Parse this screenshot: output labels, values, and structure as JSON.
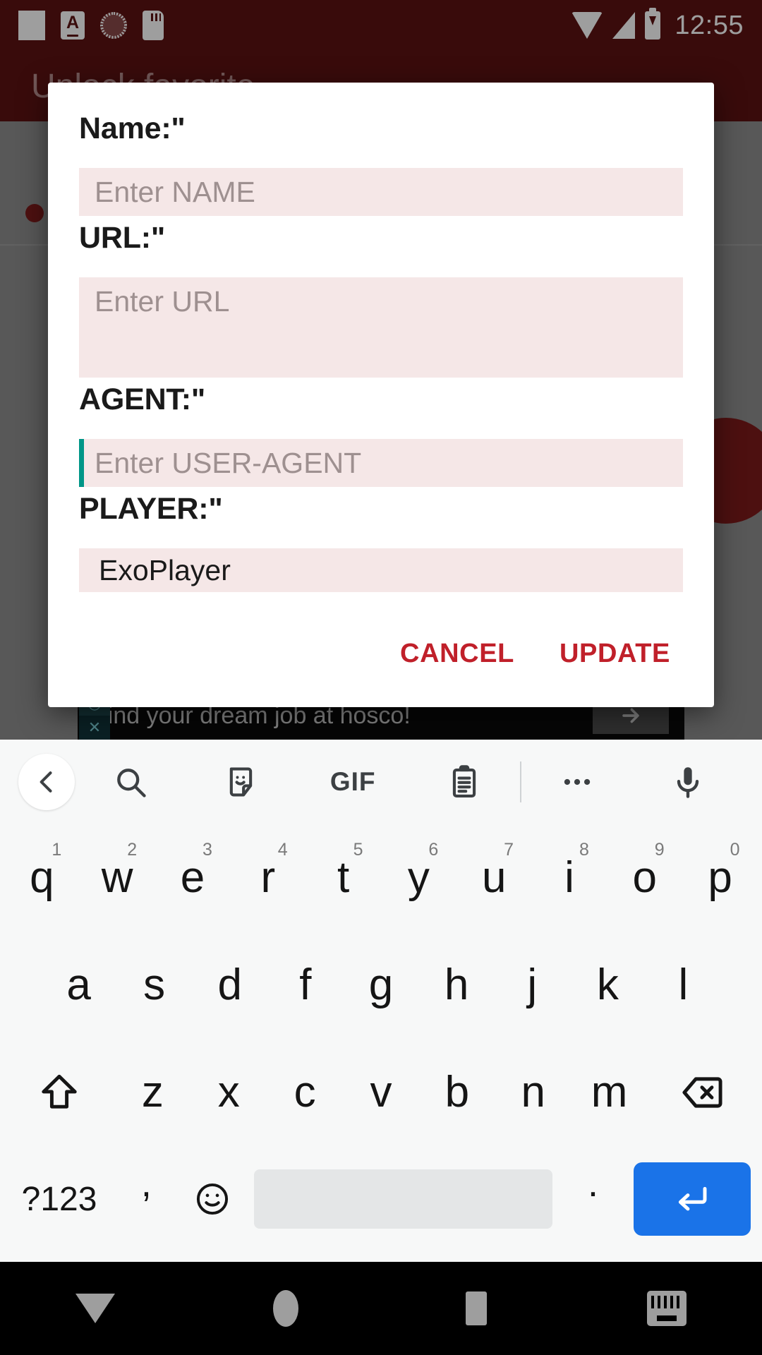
{
  "status_bar": {
    "time": "12:55",
    "icons": [
      "blank-notification-icon",
      "a-letter-icon",
      "loading-circle-icon",
      "sd-card-icon"
    ],
    "right_icons": [
      "wifi-icon",
      "cell-signal-icon",
      "battery-charging-icon"
    ],
    "background_color": "#5c1212"
  },
  "background_app": {
    "title": "Unlock favorite",
    "ad_text": "Find your dream job at hosco!",
    "ad_badge_top": "◎",
    "ad_badge_bottom": "✕"
  },
  "dialog": {
    "fields": [
      {
        "label": "Name:\"",
        "placeholder": "Enter NAME",
        "value": ""
      },
      {
        "label": "URL:\"",
        "placeholder": "Enter URL",
        "value": ""
      },
      {
        "label": "AGENT:\"",
        "placeholder": "Enter USER-AGENT",
        "value": "",
        "focused": true
      },
      {
        "label": "PLAYER:\"",
        "placeholder": "",
        "value": "ExoPlayer"
      }
    ],
    "cancel_label": "CANCEL",
    "update_label": "UPDATE",
    "accent_color": "#c0202a",
    "field_background": "#f5e7e7",
    "caret_color": "#009688"
  },
  "keyboard": {
    "toolbar": [
      "back-chevron-icon",
      "search-icon",
      "sticker-icon",
      "gif-icon",
      "clipboard-icon",
      "divider",
      "more-options-icon",
      "microphone-icon"
    ],
    "gif_label": "GIF",
    "row1": [
      {
        "key": "q",
        "num": "1"
      },
      {
        "key": "w",
        "num": "2"
      },
      {
        "key": "e",
        "num": "3"
      },
      {
        "key": "r",
        "num": "4"
      },
      {
        "key": "t",
        "num": "5"
      },
      {
        "key": "y",
        "num": "6"
      },
      {
        "key": "u",
        "num": "7"
      },
      {
        "key": "i",
        "num": "8"
      },
      {
        "key": "o",
        "num": "9"
      },
      {
        "key": "p",
        "num": "0"
      }
    ],
    "row2": [
      "a",
      "s",
      "d",
      "f",
      "g",
      "h",
      "j",
      "k",
      "l"
    ],
    "row3": [
      "z",
      "x",
      "c",
      "v",
      "b",
      "n",
      "m"
    ],
    "shift_icon": "shift-arrow-icon",
    "backspace_icon": "backspace-icon",
    "symbols_label": "?123",
    "comma_label": ",",
    "emoji_icon": "emoji-smiley-icon",
    "space_label": "",
    "period_label": ".",
    "enter_icon": "enter-arrow-icon",
    "enter_color": "#1a73e8"
  },
  "nav_bar": {
    "buttons": [
      "back-button",
      "home-button",
      "recents-button",
      "keyboard-switch-button"
    ]
  }
}
